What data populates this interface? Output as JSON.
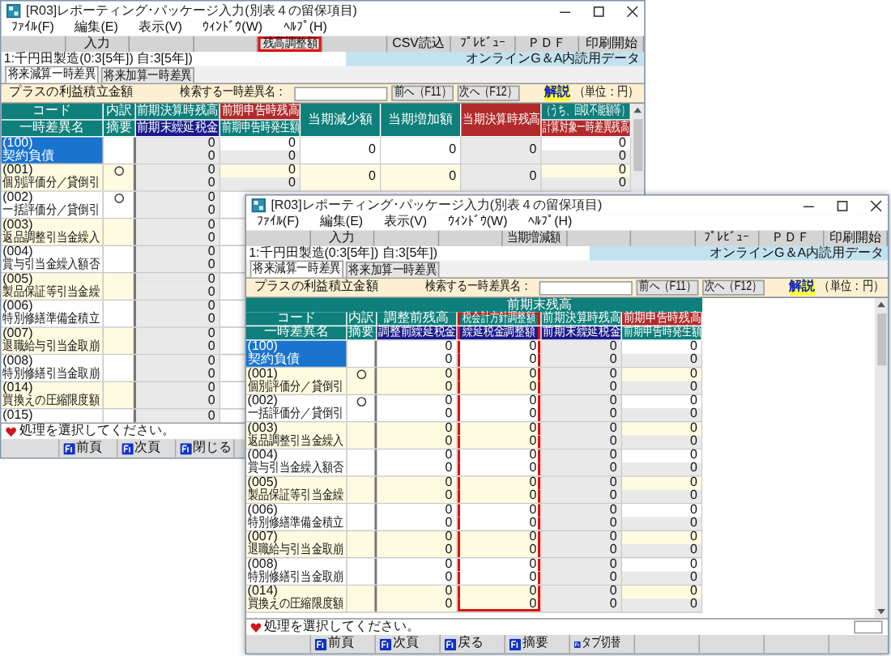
{
  "windows": [
    {
      "title": "[R03]レポーティング･パッケージ入力(別表４の留保項目)",
      "menu": [
        "ﾌｧｲﾙ(F)",
        "編集(E)",
        "表示(V)",
        "ｳｨﾝﾄﾞｳ(W)",
        "ﾍﾙﾌﾟ(H)"
      ],
      "toolbar": [
        {
          "kind": "blank"
        },
        {
          "kind": "button",
          "label": "入力",
          "highlighted": false
        },
        {
          "kind": "blank"
        },
        {
          "kind": "blank"
        },
        {
          "kind": "button",
          "label": "残高調整額",
          "highlighted": true
        },
        {
          "kind": "blank"
        },
        {
          "kind": "button",
          "label": "CSV読込",
          "highlighted": false
        },
        {
          "kind": "button",
          "label": "ﾌﾟﾚﾋﾞｭｰ",
          "highlighted": false
        },
        {
          "kind": "button",
          "label": "ＰＤＦ",
          "highlighted": false
        },
        {
          "kind": "button",
          "label": "印刷開始",
          "highlighted": false
        }
      ],
      "company": "1:千円田製造(0:3[5年]) 自:3[5年])",
      "banner": "オンラインG＆A内読用データ",
      "tabs": [
        {
          "label": "将来減算一時差異",
          "selected": true
        },
        {
          "label": "将来加算一時差異",
          "selected": false
        }
      ],
      "section_label": "プラスの利益積立金額",
      "search": {
        "label": "検索する一時差異名："
      },
      "nav_buttons": [
        "前へ（F11）",
        "次へ（F12）"
      ],
      "help": "解説",
      "unit": "（単位：円）",
      "table": {
        "code_header": [
          "コード",
          "一時差異名"
        ],
        "memo_header": [
          "内訳",
          "摘要"
        ],
        "columns": [
          {
            "header": [
              {
                "text": "前期決算時残高",
                "color": "#0e7f7a"
              },
              {
                "text": "前期末繰延税金",
                "color": "#1a1a8c"
              }
            ],
            "kind": "calc",
            "highlighted": false
          },
          {
            "header": [
              {
                "text": "前期申告時残高",
                "color": "#b22a2a"
              },
              {
                "text": "前期申告時発生額",
                "color": "#0e7f7a"
              }
            ],
            "kind": "split",
            "highlighted": false
          },
          {
            "header": [
              {
                "text": "当期減少額",
                "color": "#0e7f7a"
              }
            ],
            "kind": "input",
            "highlighted": false
          },
          {
            "header": [
              {
                "text": "当期増加額",
                "color": "#0e7f7a"
              }
            ],
            "kind": "input",
            "highlighted": false
          },
          {
            "header": [
              {
                "text": "当期決算時残高",
                "color": "#b22a2a"
              }
            ],
            "kind": "calc",
            "highlighted": false
          },
          {
            "header": [
              {
                "text": "（うち、回収不能額等）",
                "color": "#0e7f7a"
              },
              {
                "text": "計算対象一時差異残高",
                "color": "#b22a2a"
              }
            ],
            "kind": "split",
            "highlighted": false
          }
        ],
        "rows": [
          {
            "code": "(100)",
            "name": "契約負債",
            "selected": true,
            "breakdown": false,
            "cells": [
              [
                "0",
                "0"
              ],
              [
                "0",
                "0"
              ],
              [
                "0"
              ],
              [
                "0"
              ],
              [
                "0"
              ],
              [
                "0",
                "0"
              ]
            ]
          },
          {
            "code": "(001)",
            "name": "個別評価分／貸倒引",
            "selected": false,
            "breakdown": true,
            "cells": [
              [
                "0",
                "0"
              ],
              [
                "0",
                "0"
              ],
              [
                "0"
              ],
              [
                "0"
              ],
              [
                "0"
              ],
              [
                "0",
                "0"
              ]
            ]
          },
          {
            "code": "(002)",
            "name": "一括評価分／貸倒引",
            "selected": false,
            "breakdown": true,
            "cells": [
              [
                "0",
                "0"
              ]
            ]
          },
          {
            "code": "(003)",
            "name": "返品調整引当金繰入",
            "selected": false,
            "breakdown": false,
            "cells": [
              [
                "0",
                "0"
              ]
            ]
          },
          {
            "code": "(004)",
            "name": "賞与引当金繰入額否",
            "selected": false,
            "breakdown": false,
            "cells": [
              [
                "0",
                "0"
              ]
            ]
          },
          {
            "code": "(005)",
            "name": "製品保証等引当金繰",
            "selected": false,
            "breakdown": false,
            "cells": [
              [
                "0",
                "0"
              ]
            ]
          },
          {
            "code": "(006)",
            "name": "特別修繕準備金積立",
            "selected": false,
            "breakdown": false,
            "cells": [
              [
                "0",
                "0"
              ]
            ]
          },
          {
            "code": "(007)",
            "name": "退職給与引当金取崩",
            "selected": false,
            "breakdown": false,
            "cells": [
              [
                "0",
                "0"
              ]
            ]
          },
          {
            "code": "(008)",
            "name": "特別修繕引当金取崩",
            "selected": false,
            "breakdown": false,
            "cells": [
              [
                "0",
                "0"
              ]
            ]
          },
          {
            "code": "(014)",
            "name": "買換えの圧縮限度額",
            "selected": false,
            "breakdown": false,
            "cells": [
              [
                "0",
                "0"
              ]
            ]
          },
          {
            "code": "(015)",
            "selected": false,
            "breakdown": false,
            "cells": [
              [
                "0"
              ]
            ]
          }
        ]
      },
      "status": "処理を選択してください。",
      "function_keys": [
        {
          "kind": "blank"
        },
        {
          "kind": "key",
          "label": "前頁"
        },
        {
          "kind": "key",
          "label": "次頁"
        },
        {
          "kind": "key",
          "label": "閉じる"
        }
      ]
    },
    {
      "title": "[R03]レポーティング･パッケージ入力(別表４の留保項目)",
      "menu": [
        "ﾌｧｲﾙ(F)",
        "編集(E)",
        "表示(V)",
        "ｳｨﾝﾄﾞｳ(W)",
        "ﾍﾙﾌﾟ(H)"
      ],
      "toolbar": [
        {
          "kind": "blank"
        },
        {
          "kind": "button",
          "label": "入力",
          "highlighted": false
        },
        {
          "kind": "blank"
        },
        {
          "kind": "blank"
        },
        {
          "kind": "button",
          "label": "当期増減額",
          "highlighted": false
        },
        {
          "kind": "blank"
        },
        {
          "kind": "blank"
        },
        {
          "kind": "button",
          "label": "ﾌﾟﾚﾋﾞｭｰ",
          "highlighted": false
        },
        {
          "kind": "button",
          "label": "ＰＤＦ",
          "highlighted": false
        },
        {
          "kind": "button",
          "label": "印刷開始",
          "highlighted": false
        }
      ],
      "company": "1:千円田製造(0:3[5年]) 自:3[5年])",
      "banner": "オンラインG＆A内読用データ",
      "tabs": [
        {
          "label": "将来減算一時差異",
          "selected": true
        },
        {
          "label": "将来加算一時差異",
          "selected": false
        }
      ],
      "section_label": "プラスの利益積立金額",
      "search": {
        "label": "検索する一時差異名："
      },
      "nav_buttons": [
        "前へ（F11）",
        "次へ（F12）"
      ],
      "help": "解説",
      "unit": "（単位：円）",
      "table": {
        "group_header": "前期末残高",
        "code_header": [
          "コード",
          "一時差異名"
        ],
        "memo_header": [
          "内訳",
          "摘要"
        ],
        "columns": [
          {
            "header": [
              {
                "text": "調整前残高",
                "color": "#0e7f7a"
              },
              {
                "text": "調整前繰延税金",
                "color": "#1a1a8c"
              }
            ],
            "kind": "input",
            "highlighted": false
          },
          {
            "header": [
              {
                "text": "税会計方針調整額",
                "color": "#0e7f7a"
              },
              {
                "text": "繰延税金調整額",
                "color": "#1a1a8c"
              }
            ],
            "kind": "input",
            "highlighted": true
          },
          {
            "header": [
              {
                "text": "前期決算時残高",
                "color": "#0e7f7a"
              },
              {
                "text": "前期末繰延税金",
                "color": "#1a1a8c"
              }
            ],
            "kind": "calc",
            "highlighted": false
          },
          {
            "header": [
              {
                "text": "前期申告時残高",
                "color": "#b22a2a"
              },
              {
                "text": "前期申告時発生額",
                "color": "#0e7f7a"
              }
            ],
            "kind": "split",
            "highlighted": false
          }
        ],
        "rows": [
          {
            "code": "(100)",
            "name": "契約負債",
            "selected": true,
            "breakdown": false,
            "cells": [
              [
                "0",
                "0"
              ],
              [
                "0",
                "0"
              ],
              [
                "0",
                "0"
              ],
              [
                "0",
                "0"
              ]
            ]
          },
          {
            "code": "(001)",
            "name": "個別評価分／貸倒引",
            "selected": false,
            "breakdown": true,
            "cells": [
              [
                "0",
                "0"
              ],
              [
                "0",
                "0"
              ],
              [
                "0",
                "0"
              ],
              [
                "0",
                "0"
              ]
            ]
          },
          {
            "code": "(002)",
            "name": "一括評価分／貸倒引",
            "selected": false,
            "breakdown": true,
            "cells": [
              [
                "0",
                "0"
              ],
              [
                "0",
                "0"
              ],
              [
                "0",
                "0"
              ],
              [
                "0",
                "0"
              ]
            ]
          },
          {
            "code": "(003)",
            "name": "返品調整引当金繰入",
            "selected": false,
            "breakdown": false,
            "cells": [
              [
                "0",
                "0"
              ],
              [
                "0",
                "0"
              ],
              [
                "0",
                "0"
              ],
              [
                "0",
                "0"
              ]
            ]
          },
          {
            "code": "(004)",
            "name": "賞与引当金繰入額否",
            "selected": false,
            "breakdown": false,
            "cells": [
              [
                "0",
                "0"
              ],
              [
                "0",
                "0"
              ],
              [
                "0",
                "0"
              ],
              [
                "0",
                "0"
              ]
            ]
          },
          {
            "code": "(005)",
            "name": "製品保証等引当金繰",
            "selected": false,
            "breakdown": false,
            "cells": [
              [
                "0",
                "0"
              ],
              [
                "0",
                "0"
              ],
              [
                "0",
                "0"
              ],
              [
                "0",
                "0"
              ]
            ]
          },
          {
            "code": "(006)",
            "name": "特別修繕準備金積立",
            "selected": false,
            "breakdown": false,
            "cells": [
              [
                "0",
                "0"
              ],
              [
                "0",
                "0"
              ],
              [
                "0",
                "0"
              ],
              [
                "0",
                "0"
              ]
            ]
          },
          {
            "code": "(007)",
            "name": "退職給与引当金取崩",
            "selected": false,
            "breakdown": false,
            "cells": [
              [
                "0",
                "0"
              ],
              [
                "0",
                "0"
              ],
              [
                "0",
                "0"
              ],
              [
                "0",
                "0"
              ]
            ]
          },
          {
            "code": "(008)",
            "name": "特別修繕引当金取崩",
            "selected": false,
            "breakdown": false,
            "cells": [
              [
                "0",
                "0"
              ],
              [
                "0",
                "0"
              ],
              [
                "0",
                "0"
              ],
              [
                "0",
                "0"
              ]
            ]
          },
          {
            "code": "(014)",
            "name": "買換えの圧縮限度額",
            "selected": false,
            "breakdown": false,
            "cells": [
              [
                "0",
                "0"
              ],
              [
                "0",
                "0"
              ],
              [
                "0",
                "0"
              ],
              [
                "0",
                "0"
              ]
            ]
          }
        ]
      },
      "status": "処理を選択してください。",
      "function_keys": [
        {
          "kind": "blank"
        },
        {
          "kind": "key",
          "label": "前頁"
        },
        {
          "kind": "key",
          "label": "次頁"
        },
        {
          "kind": "key",
          "label": "戻る"
        },
        {
          "kind": "key",
          "label": "摘要"
        },
        {
          "kind": "key",
          "label": "タブ切替"
        },
        {
          "kind": "blank"
        },
        {
          "kind": "blank"
        },
        {
          "kind": "blank"
        },
        {
          "kind": "blank"
        }
      ]
    }
  ]
}
